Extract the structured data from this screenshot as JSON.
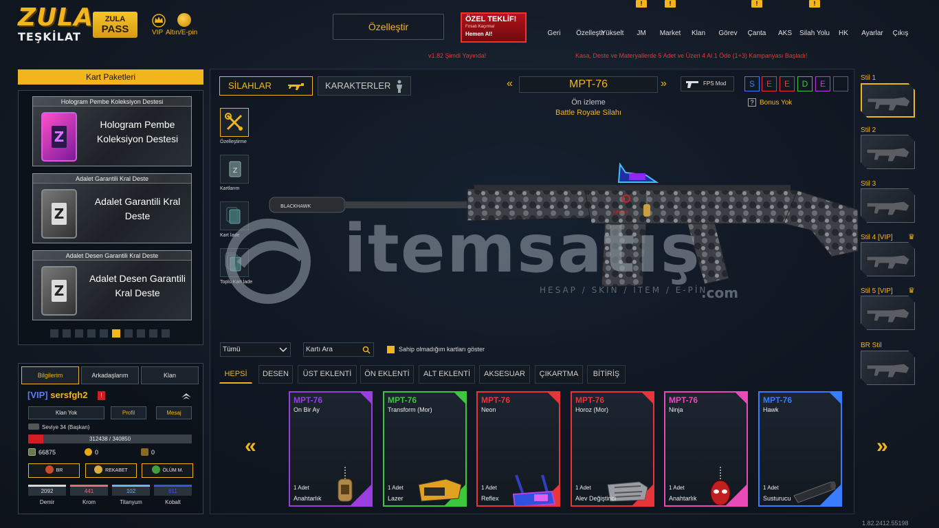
{
  "brand": {
    "logo_line1": "ZULA",
    "logo_line2": "TEŞKİLAT",
    "pass_line1": "ZULA",
    "pass_line2": "PASS",
    "vip_label": "VIP",
    "gold_label": "Altın/E-pin"
  },
  "header": {
    "customize_label": "Özelleştir",
    "offer": {
      "title": "ÖZEL TEKLİF!",
      "subtitle": "Fırsatı Kaçırma!",
      "cta": "Hemen Al!"
    },
    "nav": [
      {
        "label": "Geri",
        "icon": "back-icon"
      },
      {
        "label": "Özelleştir",
        "icon": "tools-icon"
      },
      {
        "label": "Yükselt",
        "icon": "upgrade-icon"
      },
      {
        "label": "JM",
        "icon": "coins-icon",
        "flag": "!"
      },
      {
        "label": "Market",
        "icon": "cart-icon",
        "flag": "!"
      },
      {
        "label": "Klan",
        "icon": "clan-icon"
      },
      {
        "label": "Görev",
        "icon": "task-icon"
      },
      {
        "label": "Çanta",
        "icon": "bag-icon",
        "flag": "!"
      },
      {
        "label": "AKS",
        "icon": "crosshair-icon"
      },
      {
        "label": "Silah Yolu",
        "icon": "gun-icon",
        "flag": "!"
      },
      {
        "label": "HK",
        "icon": "wallet-icon"
      },
      {
        "label": "Ayarlar",
        "icon": "gear-icon"
      },
      {
        "label": "Çıkış",
        "icon": "power-icon"
      }
    ],
    "ticker_left": "v1.82 Şimdi Yayında!",
    "ticker_right": "Kasa, Deste ve Materyallerde 5 Adet ve Üzeri 4 Al 1 Öde (1+3) Kampanyası Başladı!"
  },
  "packs": {
    "title": "Kart Paketleri",
    "items": [
      {
        "title": "Hologram Pembe Koleksiyon Destesi",
        "name": "Hologram Pembe Koleksiyon Destesi",
        "style": "pink"
      },
      {
        "title": "Adalet Garantili Kral Deste",
        "name": "Adalet Garantili Kral Deste",
        "style": "silver"
      },
      {
        "title": "Adalet Desen Garantili Kral Deste",
        "name": "Adalet Desen Garantili Kral Deste",
        "style": "silver"
      }
    ],
    "page_count": 10,
    "active_page": 6
  },
  "profile": {
    "tabs": [
      "Bilgilerim",
      "Arkadaşlarım",
      "Klan"
    ],
    "active_tab": 0,
    "vip_tag": "[VIP]",
    "username": "sersfgh2",
    "alert": "!",
    "buttons": [
      "Klan Yok",
      "Profil",
      "Mesaj"
    ],
    "level_text": "Seviye 34 (Başkan)",
    "xp_text": "312438 / 340850",
    "xp_fraction": 0.092,
    "currency": [
      {
        "icon": "zcard-icon",
        "value": "66875"
      },
      {
        "icon": "gold-coin-icon",
        "value": "0"
      },
      {
        "icon": "ep-icon",
        "value": "0"
      }
    ],
    "modes": [
      "BR",
      "REKABET",
      "ÖLÜM M."
    ],
    "materials": [
      {
        "label": "Demir",
        "value": "2092",
        "color": "#d8d8d8"
      },
      {
        "label": "Krom",
        "value": "441",
        "color": "#e0707a"
      },
      {
        "label": "Titanyum",
        "value": "102",
        "color": "#6ab8e8"
      },
      {
        "label": "Kobalt",
        "value": "811",
        "color": "#3a55e0"
      }
    ]
  },
  "main": {
    "tab_weapons": "SİLAHLAR",
    "tab_characters": "KARAKTERLER",
    "weapon_name": "MPT-76",
    "preview_line1": "Ön izleme",
    "preview_line2": "Battle Royale Silahı",
    "fps_mode": "FPS Mod",
    "seede": [
      {
        "letter": "S",
        "color": "#3a7cff"
      },
      {
        "letter": "E",
        "color": "#e8353a"
      },
      {
        "letter": "E",
        "color": "#e8353a"
      },
      {
        "letter": "D",
        "color": "#3ec63e"
      },
      {
        "letter": "E",
        "color": "#b040e0"
      },
      {
        "letter": "",
        "color": "#5a6470"
      }
    ],
    "bonus_text": "Bonus Yok",
    "tools": [
      "Özelleştirme",
      "Kartlarım",
      "Kart İade",
      "Toplu Kart İade"
    ],
    "filter_all": "Tümü",
    "search_placeholder": "Kartı Ara",
    "show_unowned_label": "Sahip olmadığım kartları göster",
    "categories": [
      "HEPSİ",
      "DESEN",
      "ÜST EKLENTİ",
      "ÖN EKLENTİ",
      "ALT EKLENTİ",
      "AKSESUAR",
      "ÇIKARTMA",
      "BİTİRİŞ"
    ],
    "active_category": 0,
    "watermark_main": "itemsatış",
    "watermark_sub": "HESAP / SKIN / İTEM / E-PİN",
    "watermark_com": ".com"
  },
  "items": [
    {
      "weapon": "MPT-76",
      "name": "On Bir Ay",
      "qty": "1 Adet",
      "type": "Anahtarlık",
      "color": "#9a3ee0",
      "icon": "keychain-icon"
    },
    {
      "weapon": "MPT-76",
      "name": "Transform (Mor)",
      "qty": "1 Adet",
      "type": "Lazer",
      "color": "#3ec63e",
      "icon": "laser-icon"
    },
    {
      "weapon": "MPT-76",
      "name": "Neon",
      "qty": "1 Adet",
      "type": "Reflex",
      "color": "#e8353a",
      "icon": "reflex-icon"
    },
    {
      "weapon": "MPT-76",
      "name": "Horoz (Mor)",
      "qty": "1 Adet",
      "type": "Alev Değiştirici",
      "color": "#e8353a",
      "icon": "flash-hider-icon"
    },
    {
      "weapon": "MPT-76",
      "name": "Ninja",
      "qty": "1 Adet",
      "type": "Anahtarlık",
      "color": "#e84ab8",
      "icon": "keychain-mask-icon"
    },
    {
      "weapon": "MPT-76",
      "name": "Hawk",
      "qty": "1 Adet",
      "type": "Susturucu",
      "color": "#3a7cff",
      "icon": "silencer-icon"
    }
  ],
  "styles": [
    {
      "label": "Stil 1",
      "crown": false
    },
    {
      "label": "Stil 2",
      "crown": false
    },
    {
      "label": "Stil 3",
      "crown": false
    },
    {
      "label": "Stil 4 [VIP]",
      "crown": true
    },
    {
      "label": "Stil 5 [VIP]",
      "crown": true
    },
    {
      "label": "BR Stil",
      "crown": false
    }
  ],
  "active_style": 0,
  "version": "1.82.2412.55198"
}
